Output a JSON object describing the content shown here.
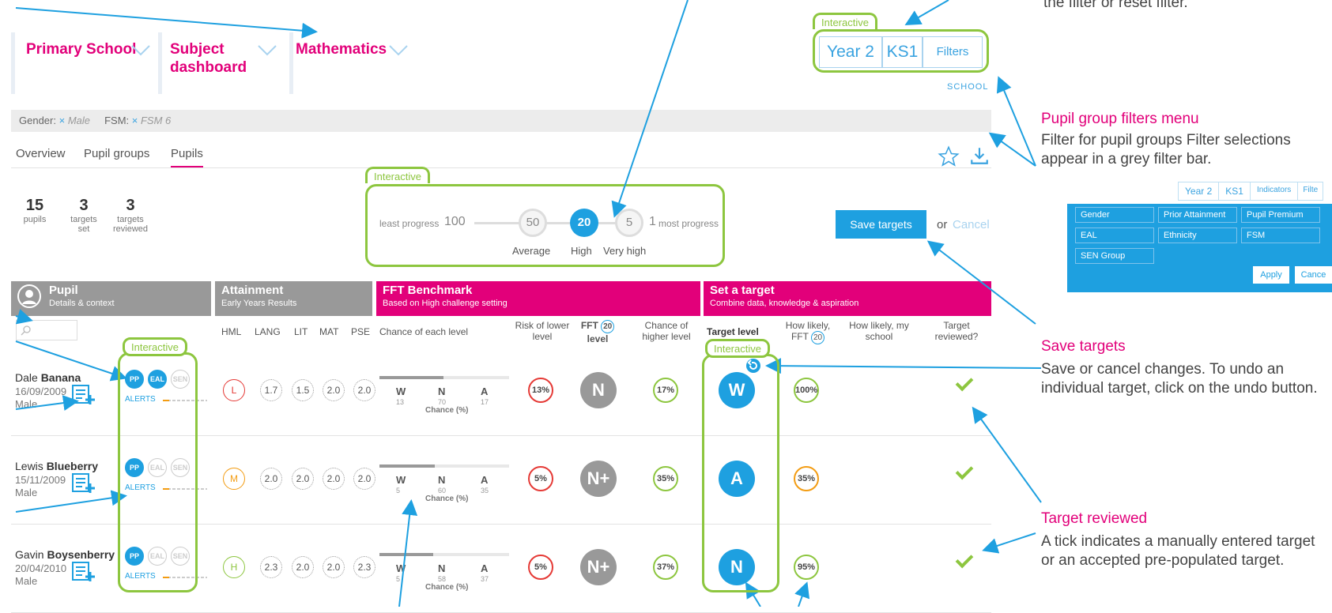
{
  "header": {
    "cards": [
      {
        "label": "Primary School"
      },
      {
        "label": "Subject dashboard"
      },
      {
        "label": "Mathematics"
      }
    ],
    "interactive_label": "Interactive",
    "segments": [
      "Year 2",
      "KS1",
      "Filters"
    ],
    "school_label": "SCHOOL"
  },
  "filterbar": {
    "gender_label": "Gender:",
    "gender_x": "×",
    "gender_value": "Male",
    "fsm_label": "FSM:",
    "fsm_x": "×",
    "fsm_value": "FSM 6"
  },
  "tabs": [
    "Overview",
    "Pupil groups",
    "Pupils"
  ],
  "stats": [
    {
      "num": "15",
      "label": "pupils"
    },
    {
      "num": "3",
      "label": "targets set"
    },
    {
      "num": "3",
      "label": "targets reviewed"
    }
  ],
  "progress": {
    "interactive_label": "Interactive",
    "least": "least progress",
    "least_num": "100",
    "steps": [
      {
        "value": "50",
        "label": "Average"
      },
      {
        "value": "20",
        "label": "High"
      },
      {
        "value": "5",
        "label": "Very high"
      }
    ],
    "most_num": "1",
    "most": "most progress"
  },
  "actions": {
    "save": "Save targets",
    "or": "or",
    "cancel": "Cancel"
  },
  "columns": {
    "pupil": {
      "title": "Pupil",
      "sub": "Details & context"
    },
    "attainment": {
      "title": "Attainment",
      "sub": "Early Years Results"
    },
    "fft": {
      "title": "FFT Benchmark",
      "sub": "Based on High challenge setting"
    },
    "target": {
      "title": "Set a target",
      "sub": "Combine data, knowledge & aspiration"
    }
  },
  "subheaders": {
    "hml": "HML",
    "lang": "LANG",
    "lit": "LIT",
    "mat": "MAT",
    "pse": "PSE",
    "chance": "Chance of each level",
    "risk": "Risk of lower level",
    "fft_a": "FFT",
    "fft_num": "20",
    "fft_b": "level",
    "higher": "Chance of higher level",
    "target_level": "Target level",
    "how_likely": "How likely,",
    "how_likely_fft": "FFT",
    "how_likely_fft_num": "20",
    "how_school": "How likely, my school",
    "reviewed": "Target reviewed?",
    "interactive_pills": "Interactive",
    "interactive_target": "Interactive"
  },
  "pupils": [
    {
      "first": "Dale",
      "last": "Banana",
      "dob": "16/09/2009",
      "gender": "Male",
      "pills": [
        "PP",
        "EAL",
        "SEN"
      ],
      "pills_on": [
        true,
        true,
        false
      ],
      "alerts": "ALERTS",
      "hml": "L",
      "hml_color": "#e53935",
      "scores": [
        "1.7",
        "1.5",
        "2.0",
        "2.0"
      ],
      "bars": [
        {
          "l": "W",
          "v": "13"
        },
        {
          "l": "N",
          "v": "70"
        },
        {
          "l": "A",
          "v": "17"
        }
      ],
      "chance_label": "Chance (%)",
      "risk": "13%",
      "fft": "N",
      "higher": "17%",
      "target": "W",
      "likely": "100%",
      "likely_color": "#8dc63f"
    },
    {
      "first": "Lewis",
      "last": "Blueberry",
      "dob": "15/11/2009",
      "gender": "Male",
      "pills": [
        "PP",
        "EAL",
        "SEN"
      ],
      "pills_on": [
        true,
        false,
        false
      ],
      "alerts": "ALERTS",
      "hml": "M",
      "hml_color": "#f39c12",
      "scores": [
        "2.0",
        "2.0",
        "2.0",
        "2.0"
      ],
      "bars": [
        {
          "l": "W",
          "v": "5"
        },
        {
          "l": "N",
          "v": "60"
        },
        {
          "l": "A",
          "v": "35"
        }
      ],
      "chance_label": "Chance (%)",
      "risk": "5%",
      "fft": "N+",
      "higher": "35%",
      "target": "A",
      "likely": "35%",
      "likely_color": "#f39c12"
    },
    {
      "first": "Gavin",
      "last": "Boysenberry",
      "dob": "20/04/2010",
      "gender": "Male",
      "pills": [
        "PP",
        "EAL",
        "SEN"
      ],
      "pills_on": [
        true,
        false,
        false
      ],
      "alerts": "ALERTS",
      "hml": "H",
      "hml_color": "#8dc63f",
      "scores": [
        "2.3",
        "2.0",
        "2.0",
        "2.3"
      ],
      "bars": [
        {
          "l": "W",
          "v": "5"
        },
        {
          "l": "N",
          "v": "58"
        },
        {
          "l": "A",
          "v": "37"
        }
      ],
      "chance_label": "Chance (%)",
      "risk": "5%",
      "fft": "N+",
      "higher": "37%",
      "target": "N",
      "likely": "95%",
      "likely_color": "#8dc63f"
    }
  ],
  "notes": {
    "top_right": "the filter or reset filter.",
    "filters_h": "Pupil group filters menu",
    "filters_t": "Filter for pupil groups Filter selections appear in a grey filter bar.",
    "save_h": "Save targets",
    "save_t": "Save or cancel changes. To undo an individual target, click on the undo button.",
    "reviewed_h": "Target reviewed",
    "reviewed_t": "A tick indicates a manually entered target or an accepted pre-populated target."
  },
  "mini_filter": {
    "tabs": [
      "Year 2",
      "KS1",
      "Indicators",
      "Filte"
    ],
    "dropdowns": [
      "Gender",
      "Prior Attainment",
      "Pupil Premium",
      "EAL",
      "Ethnicity",
      "FSM",
      "SEN Group"
    ],
    "apply": "Apply",
    "cancel": "Cance"
  },
  "colors": {
    "magenta": "#e2007a",
    "blue": "#1ea0e0",
    "green": "#8dc63f",
    "grey_header": "#999999"
  }
}
